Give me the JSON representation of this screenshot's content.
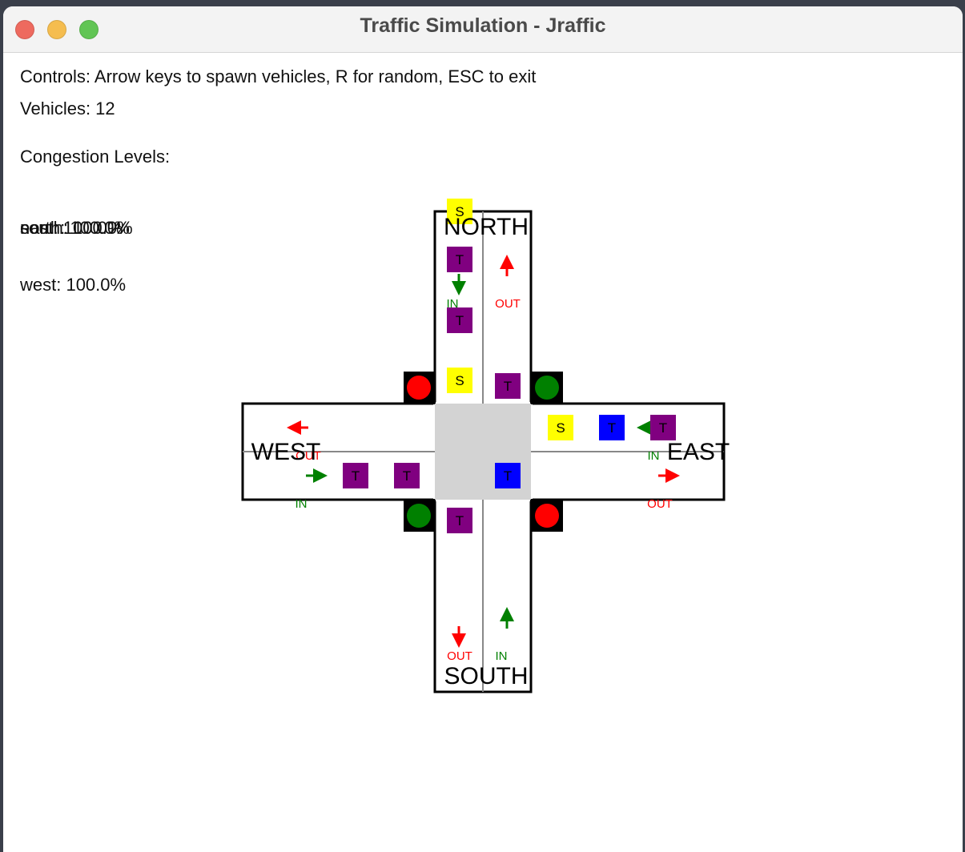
{
  "window": {
    "title": "Traffic Simulation - Jraffic"
  },
  "info": {
    "controls": "Controls: Arrow keys to spawn vehicles, R for random, ESC to exit",
    "vehicles": "Vehicles: 12",
    "congestion_header": "Congestion Levels:",
    "overlapping_levels": [
      "north: 100.0%",
      "south: 100.0%",
      "east: 100.0%"
    ],
    "west_level": "west: 100.0%"
  },
  "roads": {
    "north": "NORTH",
    "south": "SOUTH",
    "east": "EAST",
    "west": "WEST",
    "in_label": "IN",
    "out_label": "OUT"
  },
  "vehicle_labels": {
    "truck": "T",
    "sedan": "S"
  },
  "colors": {
    "truck": "#800080",
    "truck_blue": "#0000ff",
    "sedan": "#ffff00",
    "light_red": "#ff0000",
    "light_green": "#008000",
    "arrow_in": "#008000",
    "arrow_out": "#ff0000",
    "intersection": "#d3d3d3"
  },
  "traffic_lights": [
    {
      "corner": "north-west",
      "state": "red"
    },
    {
      "corner": "north-east",
      "state": "green"
    },
    {
      "corner": "south-west",
      "state": "green"
    },
    {
      "corner": "south-east",
      "state": "red"
    }
  ],
  "vehicles": [
    {
      "road": "north",
      "type": "sedan",
      "label": "S"
    },
    {
      "road": "north",
      "type": "truck",
      "label": "T"
    },
    {
      "road": "north",
      "type": "truck",
      "label": "T"
    },
    {
      "road": "north",
      "type": "sedan",
      "label": "S"
    },
    {
      "road": "north",
      "type": "truck",
      "label": "T"
    },
    {
      "road": "east",
      "type": "sedan",
      "label": "S"
    },
    {
      "road": "east",
      "type": "truck_blue",
      "label": "T"
    },
    {
      "road": "east",
      "type": "truck",
      "label": "T"
    },
    {
      "road": "west",
      "type": "truck",
      "label": "T"
    },
    {
      "road": "west",
      "type": "truck",
      "label": "T"
    },
    {
      "road": "center",
      "type": "truck_blue",
      "label": "T"
    },
    {
      "road": "south",
      "type": "truck",
      "label": "T"
    }
  ]
}
